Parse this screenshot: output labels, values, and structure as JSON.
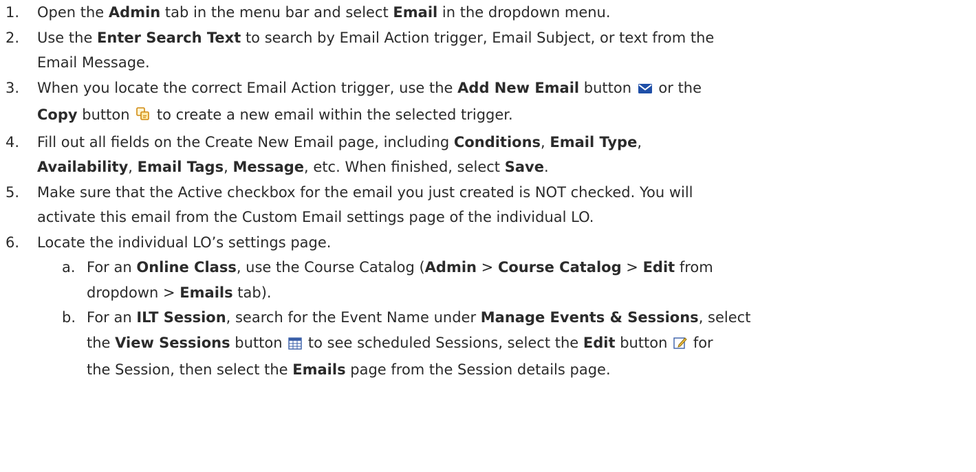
{
  "steps": {
    "s1": {
      "num": "1.",
      "t1": "Open the ",
      "b1": "Admin",
      "t2": " tab in the menu bar and select ",
      "b2": "Email",
      "t3": " in the dropdown menu."
    },
    "s2": {
      "num": "2.",
      "t1": "Use the ",
      "b1": "Enter Search Text",
      "t2": " to search by Email Action trigger, Email Subject, or text from the",
      "l2": "Email Message."
    },
    "s3": {
      "num": "3.",
      "t1": "When you locate the correct Email Action trigger, use the ",
      "b1": "Add New Email",
      "t2": " button ",
      "t3": " or the",
      "b2": "Copy",
      "t4": " button ",
      "t5": " to create a new email within the selected trigger."
    },
    "s4": {
      "num": "4.",
      "t1": "Fill out all fields on the Create New Email page, including ",
      "b1": "Conditions",
      "t2": ", ",
      "b2": "Email Type",
      "t3": ",",
      "b3": "Availability",
      "t4": ", ",
      "b4": "Email Tags",
      "t5": ", ",
      "b5": "Message",
      "t6": ", etc. When finished, select ",
      "b6": "Save",
      "t7": "."
    },
    "s5": {
      "num": "5.",
      "l1": "Make sure that the Active checkbox for the email you just created is NOT checked. You will",
      "l2": "activate this email from the Custom Email settings page of the individual LO."
    },
    "s6": {
      "num": "6.",
      "l1": "Locate the individual LO’s settings page."
    },
    "s6a": {
      "num": "a.",
      "t1": "For an ",
      "b1": "Online Class",
      "t2": ", use the Course Catalog (",
      "b2": "Admin",
      "t3": " > ",
      "b3": "Course Catalog",
      "t4": " > ",
      "b4": "Edit",
      "t5": " from",
      "l2a": "dropdown > ",
      "b5": "Emails",
      "l2b": " tab)."
    },
    "s6b": {
      "num": "b.",
      "t1": "For an ",
      "b1": "ILT Session",
      "t2": ", search for the Event Name under ",
      "b2": "Manage Events & Sessions",
      "t3": ", select",
      "l2a": "the ",
      "b3": "View Sessions",
      "l2b": " button ",
      "l2c": " to see scheduled Sessions, select the ",
      "b4": "Edit",
      "l2d": " button ",
      "l2e": " for",
      "l3a": "the Session, then select the ",
      "b5": "Emails",
      "l3b": " page from the Session details page."
    }
  },
  "icons": {
    "email": "envelope-icon",
    "copy": "copy-icon",
    "sessions": "calendar-grid-icon",
    "edit": "edit-pencil-icon",
    "envelope_color": "#1f4fa8",
    "copy_color": "#f0a020"
  }
}
